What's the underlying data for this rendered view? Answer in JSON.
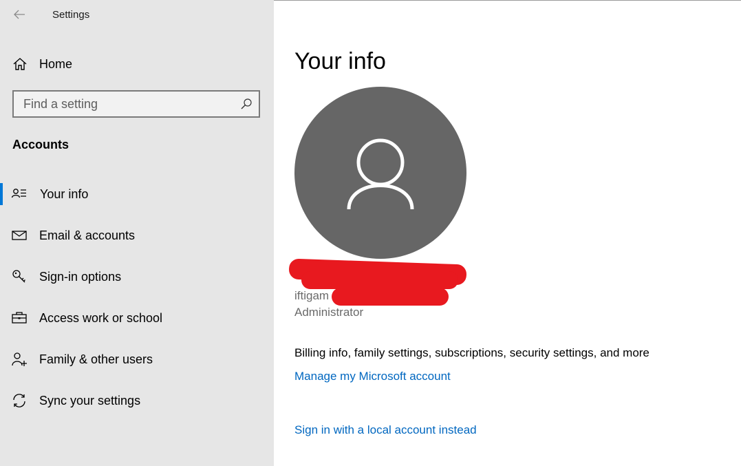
{
  "window": {
    "title": "Settings"
  },
  "sidebar": {
    "home_label": "Home",
    "search": {
      "placeholder": "Find a setting",
      "value": ""
    },
    "section_heading": "Accounts",
    "items": [
      {
        "label": "Your info",
        "icon": "person-card-icon",
        "selected": true
      },
      {
        "label": "Email & accounts",
        "icon": "envelope-icon",
        "selected": false
      },
      {
        "label": "Sign-in options",
        "icon": "key-icon",
        "selected": false
      },
      {
        "label": "Access work or school",
        "icon": "briefcase-icon",
        "selected": false
      },
      {
        "label": "Family & other users",
        "icon": "add-person-icon",
        "selected": false
      },
      {
        "label": "Sync your settings",
        "icon": "sync-icon",
        "selected": false
      }
    ]
  },
  "main": {
    "title": "Your info",
    "user": {
      "name_visible": "",
      "email_prefix": "iftigam",
      "role": "Administrator"
    },
    "billing_text": "Billing info, family settings, subscriptions, security settings, and more",
    "manage_link": "Manage my Microsoft account",
    "local_account_link": "Sign in with a local account instead"
  },
  "colors": {
    "sidebar_bg": "#e6e6e6",
    "accent": "#0078d7",
    "link": "#0067c0",
    "avatar_bg": "#666666",
    "redaction": "#e8191f"
  }
}
